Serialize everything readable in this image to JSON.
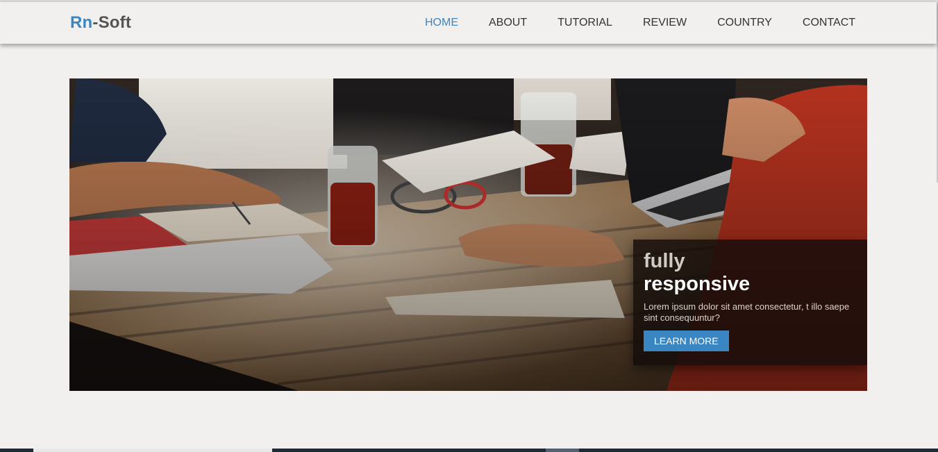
{
  "brand": {
    "part1": "Rn",
    "part2": "-Soft"
  },
  "nav": {
    "items": [
      {
        "label": "HOME",
        "active": true
      },
      {
        "label": "ABOUT",
        "active": false
      },
      {
        "label": "TUTORIAL",
        "active": false
      },
      {
        "label": "REVIEW",
        "active": false
      },
      {
        "label": "COUNTRY",
        "active": false
      },
      {
        "label": "CONTACT",
        "active": false
      }
    ]
  },
  "hero": {
    "caption": {
      "line1": "fully",
      "line2": "responsive",
      "text": "Lorem ipsum dolor sit amet consectetur, t illo saepe sint consequuntur?",
      "button": "LEARN MORE"
    }
  },
  "colors": {
    "accent": "#3b86c4",
    "background": "#f1f0ee",
    "caption_bg": "#140c0a"
  }
}
